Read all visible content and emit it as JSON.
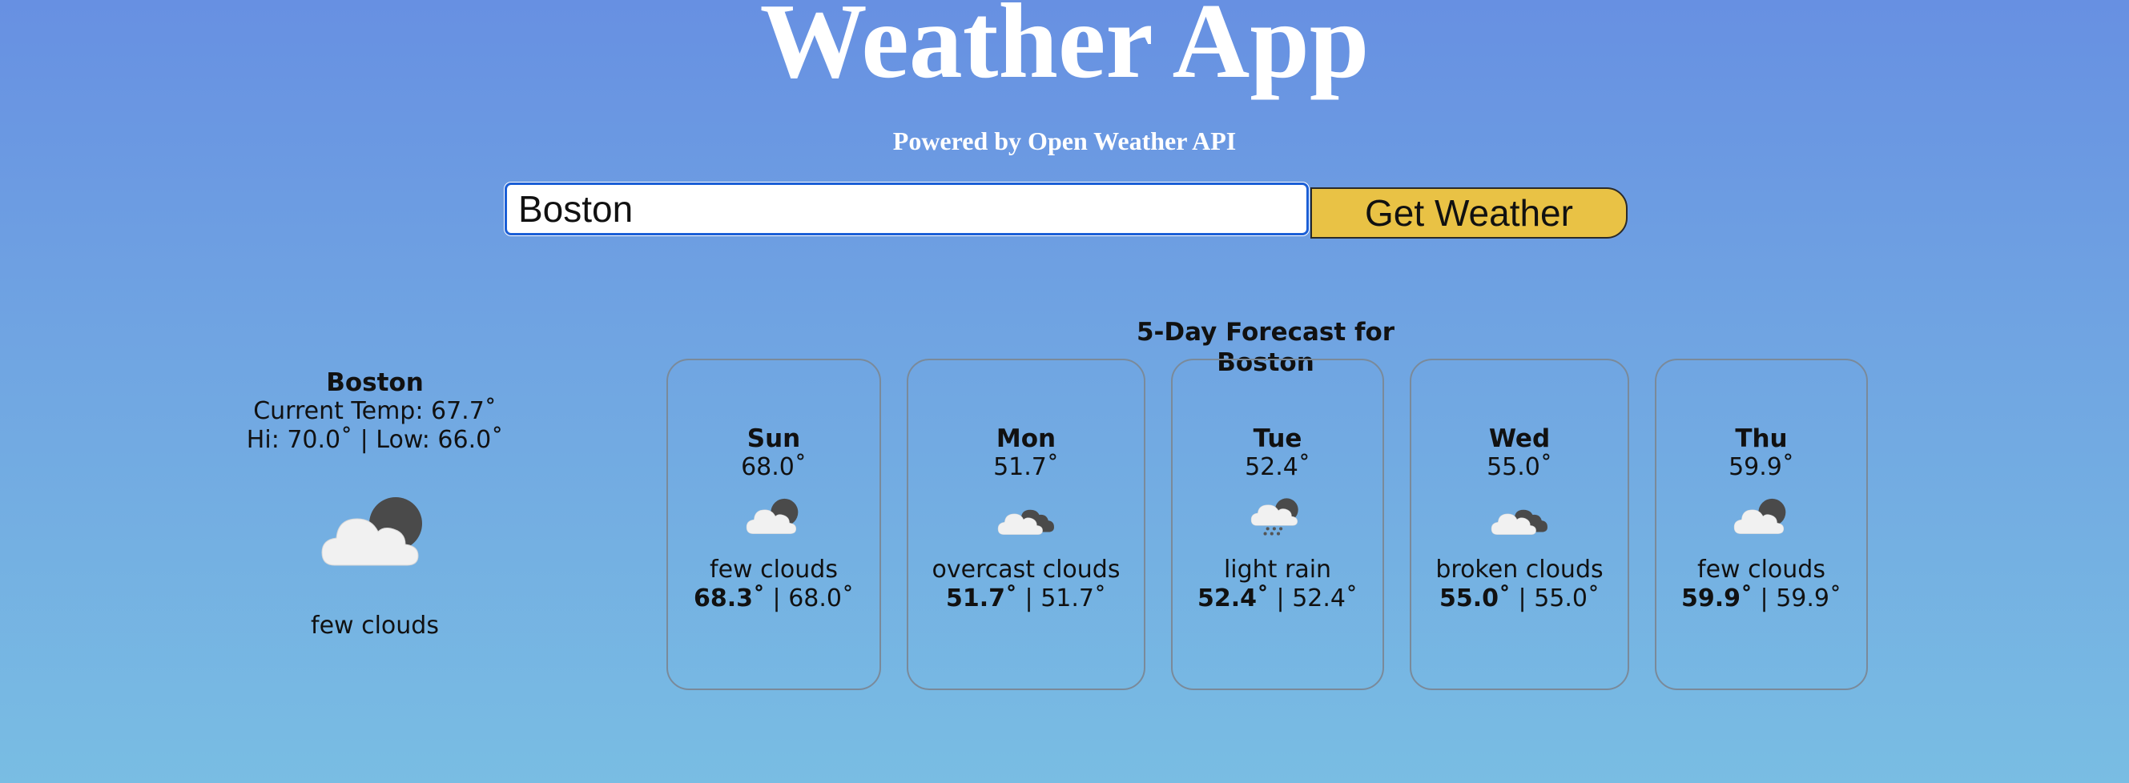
{
  "header": {
    "title": "Weather App",
    "subtitle": "Powered by Open Weather API"
  },
  "search": {
    "value": "Boston",
    "button_label": "Get Weather"
  },
  "current": {
    "city": "Boston",
    "current_temp": "Current Temp: 67.7˚",
    "hi_low": "Hi: 70.0˚ | Low: 66.0˚",
    "icon": "few-clouds-night-icon",
    "description": "few clouds"
  },
  "forecast": {
    "heading": "5-Day Forecast for Boston",
    "days": [
      {
        "day": "Sun",
        "temp": "68.0˚",
        "icon": "few-clouds-night-icon",
        "description": "few clouds",
        "hi": "68.3˚",
        "low": " | 68.0˚"
      },
      {
        "day": "Mon",
        "temp": "51.7˚",
        "icon": "overcast-clouds-icon",
        "description": "overcast clouds",
        "hi": "51.7˚",
        "low": " | 51.7˚"
      },
      {
        "day": "Tue",
        "temp": "52.4˚",
        "icon": "light-rain-icon",
        "description": "light rain",
        "hi": "52.4˚",
        "low": " | 52.4˚"
      },
      {
        "day": "Wed",
        "temp": "55.0˚",
        "icon": "broken-clouds-icon",
        "description": "broken clouds",
        "hi": "55.0˚",
        "low": " | 55.0˚"
      },
      {
        "day": "Thu",
        "temp": "59.9˚",
        "icon": "few-clouds-night-icon",
        "description": "few clouds",
        "hi": "59.9˚",
        "low": " | 59.9˚"
      }
    ]
  },
  "colors": {
    "background_top": "#6790e2",
    "background_bottom": "#79bde3",
    "button": "#e9c245",
    "input_border": "#1b5fd6"
  }
}
